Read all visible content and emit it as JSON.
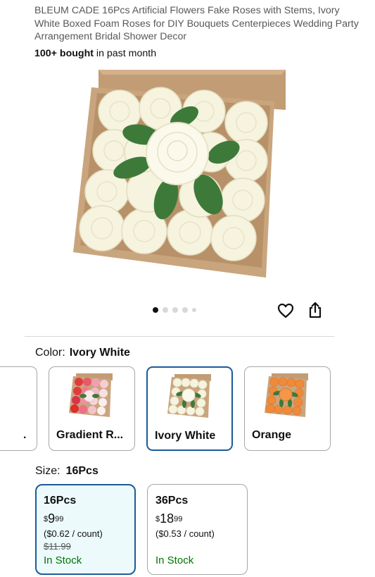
{
  "product": {
    "title": "BLEUM CADE 16Pcs Artificial Flowers Fake Roses with Stems, Ivory White Boxed Foam Roses for DIY Bouquets Centerpieces Wedding Party Arrangement Bridal Shower Decor",
    "bought_bold": "100+ bought",
    "bought_rest": " in past month"
  },
  "gallery": {
    "dot_count": 5,
    "active_index": 0,
    "icons": [
      "heart-icon",
      "share-icon"
    ]
  },
  "color": {
    "label": "Color:",
    "selected": "Ivory White",
    "options": [
      {
        "label": "."
      },
      {
        "label": "Gradient R..."
      },
      {
        "label": "Ivory White"
      },
      {
        "label": "Orange"
      }
    ]
  },
  "size": {
    "label": "Size:",
    "selected": "16Pcs",
    "options": [
      {
        "name": "16Pcs",
        "currency": "$",
        "whole": "9",
        "fraction": "99",
        "unit_price": "($0.62 / count)",
        "list_price": "$11.99",
        "stock": "In Stock"
      },
      {
        "name": "36Pcs",
        "currency": "$",
        "whole": "18",
        "fraction": "99",
        "unit_price": "($0.53 / count)",
        "stock": "In Stock"
      }
    ]
  },
  "colors": {
    "stock_green": "#007600",
    "selected_border": "#1b5b98",
    "selected_fill": "#edfafc",
    "box_kraft": "#c9a57e",
    "rose_ivory": "#f7f5e4",
    "leaf_green": "#3d7a3a"
  }
}
